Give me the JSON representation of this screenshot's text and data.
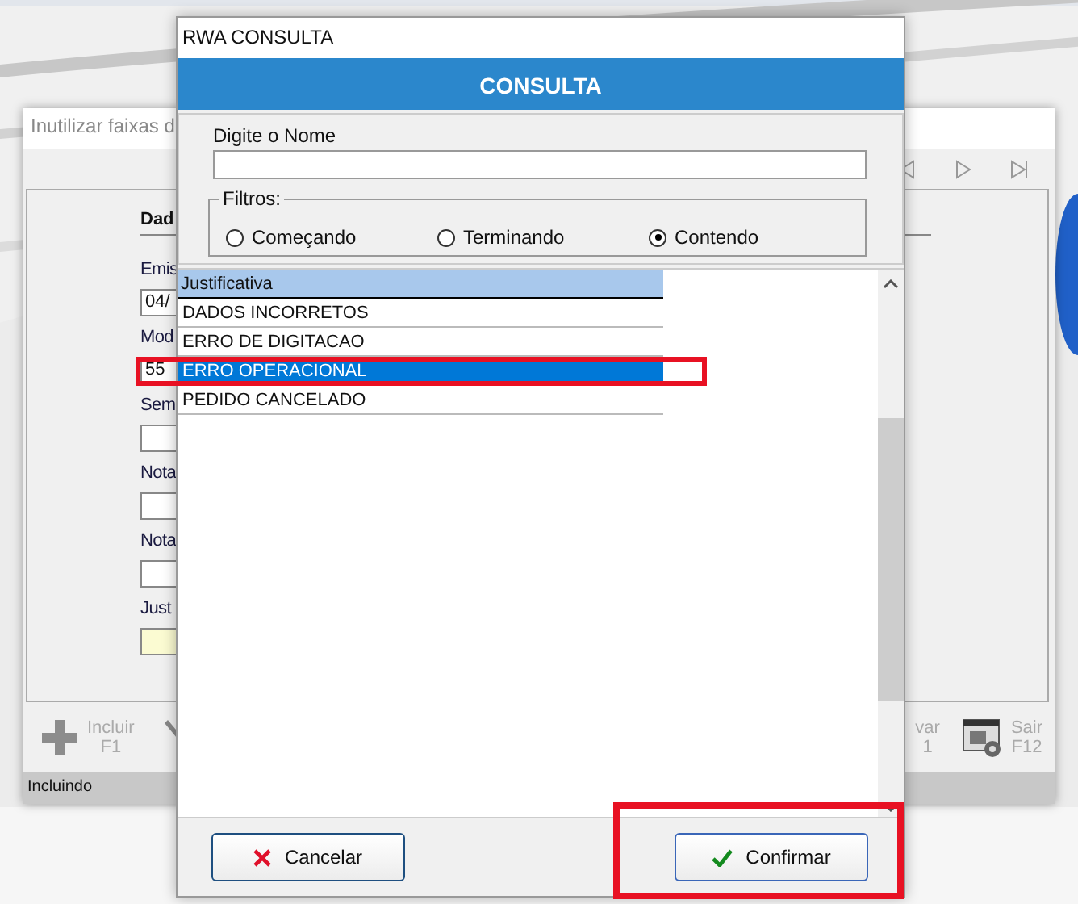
{
  "background_window": {
    "title": "Inutilizar faixas d",
    "section_title": "Dad",
    "fields": [
      {
        "label": "Emis",
        "value": "04/",
        "kind": "text"
      },
      {
        "label": "Mod",
        "value": "55",
        "kind": "text"
      },
      {
        "label": "Sem",
        "kind": "text"
      },
      {
        "label": "Nota",
        "kind": "text"
      },
      {
        "label": "Nota",
        "kind": "text"
      },
      {
        "label": "Just",
        "kind": "required"
      }
    ],
    "toolbar_left": [
      {
        "label": "Incluir",
        "shortcut": "F1"
      }
    ],
    "toolbar_right": [
      {
        "label": "var",
        "shortcut": "1"
      },
      {
        "label": "Sair",
        "shortcut": "F12"
      }
    ],
    "status": "Incluindo"
  },
  "dialog": {
    "title": "RWA CONSULTA",
    "header": "CONSULTA",
    "search": {
      "label": "Digite o Nome"
    },
    "filters": {
      "label": "Filtros:",
      "options": [
        {
          "label": "Começando",
          "selected": false
        },
        {
          "label": "Terminando",
          "selected": false
        },
        {
          "label": "Contendo",
          "selected": true
        }
      ]
    },
    "list": {
      "column": "Justificativa",
      "rows": [
        {
          "text": "DADOS INCORRETOS",
          "selected": false
        },
        {
          "text": "ERRO DE DIGITACAO",
          "selected": false
        },
        {
          "text": "ERRO OPERACIONAL",
          "selected": true
        },
        {
          "text": "PEDIDO CANCELADO",
          "selected": false
        }
      ]
    },
    "buttons": [
      {
        "label": "Cancelar",
        "kind": "cancel"
      },
      {
        "label": "Confirmar",
        "kind": "confirm"
      }
    ]
  }
}
